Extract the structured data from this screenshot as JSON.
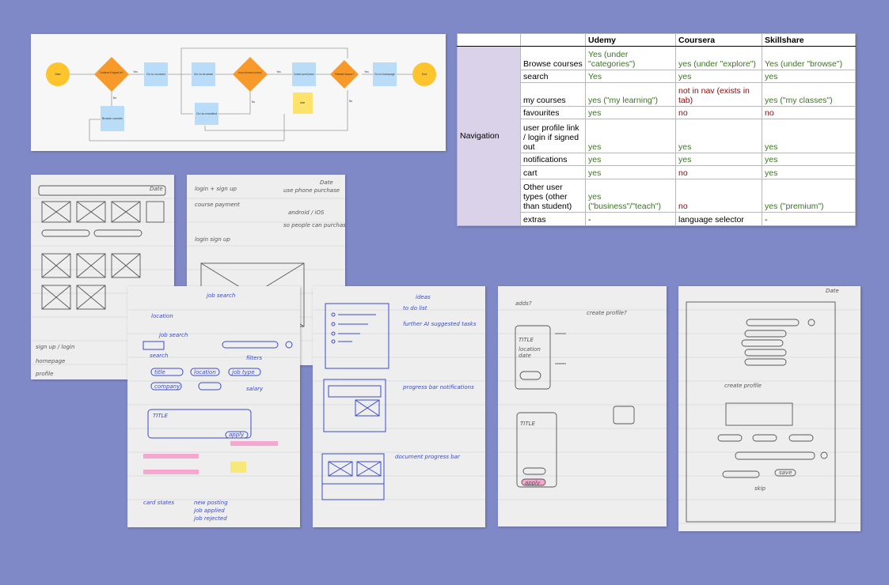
{
  "flowchart": {
    "nodes": {
      "start": "Start",
      "signed_in": "Continue if signed in?",
      "go_courses": "Go to courses",
      "go_browse": "Go to browse",
      "decide_learning": "Are you on that course on my learning?",
      "go_enrolled": "Go to enrolled",
      "continue_lesson": "Continue (current) lesson",
      "finished": "Finished lesson?",
      "go_home": "Go to homepage",
      "end": "End",
      "browse_courses": "Browse courses",
      "note": "note"
    },
    "edges": {
      "yes": "Yes",
      "no": "No"
    }
  },
  "comparison": {
    "headers": [
      "",
      "",
      "Udemy",
      "Coursera",
      "Skillshare"
    ],
    "section": "Navigation",
    "rows": [
      {
        "feature": "Browse courses",
        "udemy": "Yes (under \"categories\")",
        "coursera": "yes (under \"explore\")",
        "skillshare": "Yes (under \"browse\")",
        "uc": "g",
        "cc": "g",
        "sc": "g"
      },
      {
        "feature": "search",
        "udemy": "Yes",
        "coursera": "yes",
        "skillshare": "yes",
        "uc": "g",
        "cc": "g",
        "sc": "g"
      },
      {
        "feature": "my courses",
        "udemy": "yes (\"my learning\")",
        "coursera": "not in nav (exists in tab)",
        "skillshare": "yes (\"my classes\")",
        "uc": "g",
        "cc": "r",
        "sc": "g"
      },
      {
        "feature": "favourites",
        "udemy": "yes",
        "coursera": "no",
        "skillshare": "no",
        "uc": "g",
        "cc": "r",
        "sc": "r"
      },
      {
        "feature": "user profile link / login if signed out",
        "udemy": "yes",
        "coursera": "yes",
        "skillshare": "yes",
        "uc": "g",
        "cc": "g",
        "sc": "g"
      },
      {
        "feature": "notifications",
        "udemy": "yes",
        "coursera": "yes",
        "skillshare": "yes",
        "uc": "g",
        "cc": "g",
        "sc": "g"
      },
      {
        "feature": "cart",
        "udemy": "yes",
        "coursera": "no",
        "skillshare": "yes",
        "uc": "g",
        "cc": "r",
        "sc": "g"
      },
      {
        "feature": "Other user types (other than student)",
        "udemy": "yes (\"business\"/\"teach\")",
        "coursera": "no",
        "skillshare": "yes (\"premium\")",
        "uc": "g",
        "cc": "r",
        "sc": "g"
      },
      {
        "feature": "extras",
        "udemy": "-",
        "coursera": "language selector",
        "skillshare": "-",
        "uc": "",
        "cc": "",
        "sc": ""
      }
    ]
  },
  "sketches": {
    "s1": {
      "date": "Date",
      "l1": "sign up / login",
      "l2": "homepage",
      "l3": "profile"
    },
    "s2": {
      "date": "Date",
      "l1": "login + sign up",
      "l2": "course payment",
      "l3": "login sign up",
      "l4": "use phone purchase",
      "l5": "android / iOS",
      "l6": "so people can purchase course"
    },
    "s3": {
      "title": "job search",
      "l1": "location",
      "l2": "job search",
      "l3": "search",
      "l4": "filters",
      "l5": "title",
      "l6": "location",
      "l7": "job type",
      "l8": "company",
      "l9": "salary",
      "l10": "TITLE",
      "l11": "apply",
      "l12": "card states",
      "l13": "new posting",
      "l14": "job applied",
      "l15": "job rejected"
    },
    "s4": {
      "title": "ideas",
      "l1": "to do list",
      "l2": "further AI suggested tasks",
      "l3": "progress bar notifications",
      "l4": "document progress bar"
    },
    "s5": {
      "title": "adds?",
      "l1": "create profile?",
      "l2": "TITLE",
      "l3": "location",
      "l4": "date",
      "l5": "TITLE",
      "l6": "apply"
    },
    "s6": {
      "date": "Date",
      "l1": "create profile",
      "l2": "save",
      "l3": "skip"
    }
  }
}
